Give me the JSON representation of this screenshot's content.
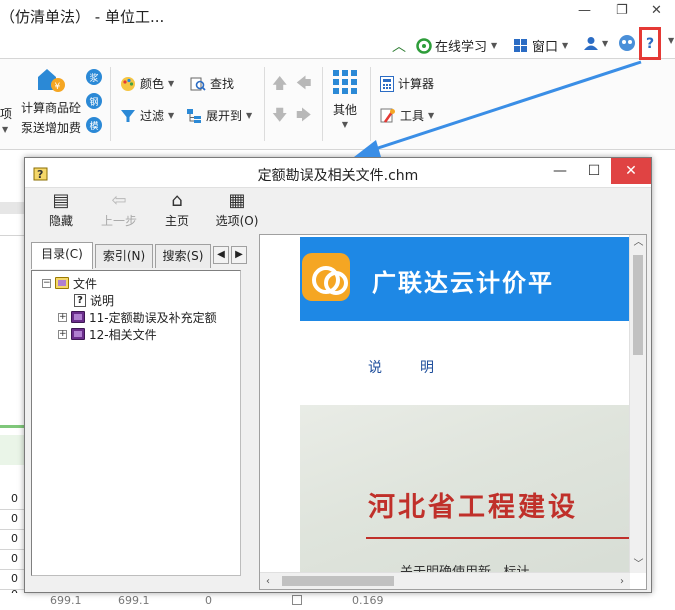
{
  "app": {
    "title": "（仿清单法） - 单位工...",
    "window_controls": {
      "minimize": "—",
      "restore": "❐",
      "close": "✕"
    }
  },
  "menu_strip": {
    "collapse_icon": "chevron-up-icon",
    "online_learning": "在线学习",
    "window": "窗口",
    "help_symbol": "?"
  },
  "ribbon": {
    "partial_left": "项",
    "calc_line1": "计算商品砼",
    "calc_line2": "泵送增加费",
    "badges": [
      "浆",
      "钢",
      "模"
    ],
    "color": "颜色",
    "find": "查找",
    "filter": "过滤",
    "expand": "展开到",
    "other": "其他",
    "calculator": "计算器",
    "tools": "工具"
  },
  "background_table": {
    "row_values": [
      "0",
      "0",
      "0",
      "0",
      "0",
      "0"
    ],
    "bottom_cells": [
      "699.1",
      "699.1",
      "0",
      "0.169"
    ]
  },
  "help_window": {
    "title": "定额勘误及相关文件.chm",
    "toolbar": [
      {
        "label": "隐藏",
        "icon": "hide-icon"
      },
      {
        "label": "上一步",
        "icon": "back-arrow-icon"
      },
      {
        "label": "主页",
        "icon": "home-icon"
      },
      {
        "label": "选项(O)",
        "icon": "options-icon"
      }
    ],
    "tabs": [
      "目录(C)",
      "索引(N)",
      "搜索(S)"
    ],
    "tree": {
      "root": "文件",
      "items": [
        {
          "label": "说明",
          "type": "page"
        },
        {
          "label": "11-定额勘误及补充定额",
          "type": "book"
        },
        {
          "label": "12-相关文件",
          "type": "book"
        }
      ]
    },
    "content": {
      "banner_text": "广联达云计价平",
      "heading": "说明",
      "photo_title": "河北省工程建设",
      "photo_subtitle": "关于明确使用新...标计"
    }
  },
  "colors": {
    "highlight": "#e53935",
    "annotation_arrow": "#3a8ee6",
    "banner_blue": "#1e88e5",
    "logo_orange": "#f5a623",
    "close_red": "#e04343"
  }
}
